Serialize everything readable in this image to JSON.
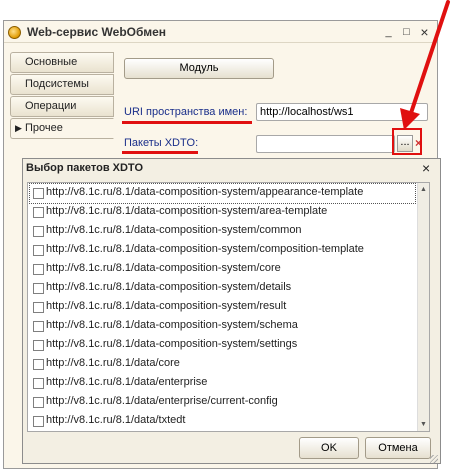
{
  "window": {
    "title": "Web-сервис WebОбмен",
    "buttons": {
      "minimize": "_",
      "maximize": "□",
      "close": "×"
    }
  },
  "tabs": [
    {
      "label": "Основные",
      "active": false
    },
    {
      "label": "Подсистемы",
      "active": false
    },
    {
      "label": "Операции",
      "active": false
    },
    {
      "label": "Прочее",
      "active": true,
      "marker": "▶"
    }
  ],
  "form": {
    "module_button": "Модуль",
    "uri_label": "URI пространства имен:",
    "uri_value": "http://localhost/ws1",
    "packages_label": "Пакеты XDTO:",
    "packages_value": "",
    "select_button": "...",
    "clear_icon": "×"
  },
  "dialog": {
    "title": "Выбор пакетов XDTO",
    "close": "×",
    "packages": [
      {
        "uri": "http://v8.1c.ru/8.1/data-composition-system/appearance-template",
        "checked": false
      },
      {
        "uri": "http://v8.1c.ru/8.1/data-composition-system/area-template",
        "checked": false
      },
      {
        "uri": "http://v8.1c.ru/8.1/data-composition-system/common",
        "checked": false
      },
      {
        "uri": "http://v8.1c.ru/8.1/data-composition-system/composition-template",
        "checked": false
      },
      {
        "uri": "http://v8.1c.ru/8.1/data-composition-system/core",
        "checked": false
      },
      {
        "uri": "http://v8.1c.ru/8.1/data-composition-system/details",
        "checked": false
      },
      {
        "uri": "http://v8.1c.ru/8.1/data-composition-system/result",
        "checked": false
      },
      {
        "uri": "http://v8.1c.ru/8.1/data-composition-system/schema",
        "checked": false
      },
      {
        "uri": "http://v8.1c.ru/8.1/data-composition-system/settings",
        "checked": false
      },
      {
        "uri": "http://v8.1c.ru/8.1/data/core",
        "checked": false
      },
      {
        "uri": "http://v8.1c.ru/8.1/data/enterprise",
        "checked": false
      },
      {
        "uri": "http://v8.1c.ru/8.1/data/enterprise/current-config",
        "checked": false
      },
      {
        "uri": "http://v8.1c.ru/8.1/data/txtedt",
        "checked": false
      }
    ],
    "ok_button": "OK",
    "cancel_button": "Отмена"
  },
  "colors": {
    "annotation_red": "#e01010",
    "label_blue": "#1a2f8a",
    "panel_bg": "#fbf6ea"
  },
  "icons": {
    "app": "1c-app-icon",
    "select": "ellipsis-icon",
    "clear": "clear-x-icon",
    "close": "close-icon"
  }
}
